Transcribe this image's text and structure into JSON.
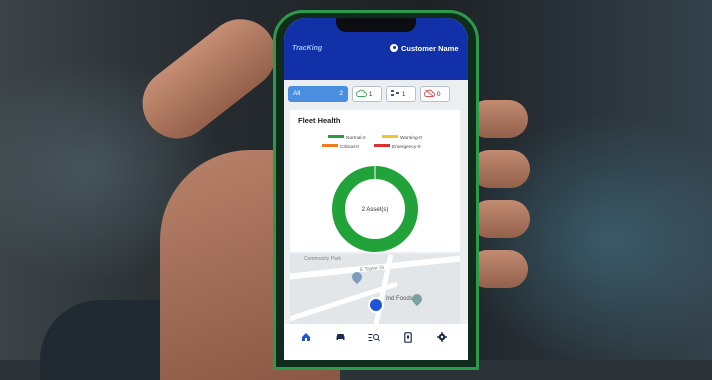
{
  "app": {
    "logo_text": "TracKing",
    "user_label": "Customer Name"
  },
  "filters": {
    "all": {
      "label": "All",
      "count": "2"
    },
    "chips": [
      {
        "icon": "cloud-icon",
        "count": "1",
        "color": "#3aa85a"
      },
      {
        "icon": "vehicle-sensor-icon",
        "count": "1",
        "color": "#555555"
      },
      {
        "icon": "cloud-off-icon",
        "count": "0",
        "color": "#e05050"
      }
    ]
  },
  "fleet_health": {
    "title": "Fleet Health",
    "center_label": "2 Asset(s)",
    "legend": [
      {
        "label": "Normal-2",
        "color": "#22a33a"
      },
      {
        "label": "Warning-0",
        "color": "#f2c233"
      },
      {
        "label": "Critical-0",
        "color": "#f07c1e"
      },
      {
        "label": "Emergency-0",
        "color": "#d93030"
      }
    ]
  },
  "chart_data": {
    "type": "pie",
    "categories": [
      "Normal",
      "Warning",
      "Critical",
      "Emergency"
    ],
    "values": [
      2,
      0,
      0,
      0
    ],
    "title": "Fleet Health"
  },
  "map": {
    "labels": [
      "Community Park",
      "E Taylor St",
      "Ind Foods"
    ]
  },
  "nav": {
    "items": [
      "home-icon",
      "car-icon",
      "list-search-icon",
      "device-icon",
      "settings-icon"
    ]
  },
  "colors": {
    "appbar": "#1230a8",
    "accent": "#1f54d6",
    "normal": "#22a33a"
  }
}
